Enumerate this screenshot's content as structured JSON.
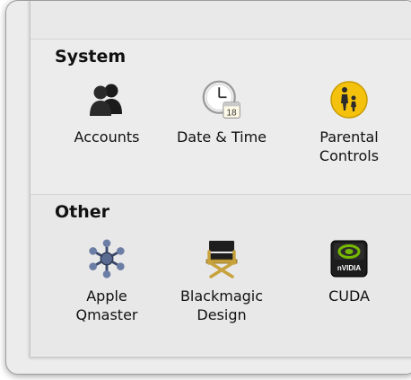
{
  "sections": {
    "system": {
      "title": "System",
      "items": [
        {
          "label": "Accounts",
          "icon": "accounts-icon"
        },
        {
          "label": "Date & Time",
          "icon": "date-time-icon"
        },
        {
          "label": "Parental\nControls",
          "icon": "parental-controls-icon"
        }
      ]
    },
    "other": {
      "title": "Other",
      "items": [
        {
          "label": "Apple\nQmaster",
          "icon": "qmaster-icon"
        },
        {
          "label": "Blackmagic\nDesign",
          "icon": "blackmagic-design-icon"
        },
        {
          "label": "CUDA",
          "icon": "cuda-icon"
        }
      ]
    }
  },
  "icons": {
    "calendar_day": "18",
    "cuda_brand": "nVIDIA"
  },
  "colors": {
    "parental_yellow": "#f4c20d",
    "nvidia_green": "#76b900"
  }
}
